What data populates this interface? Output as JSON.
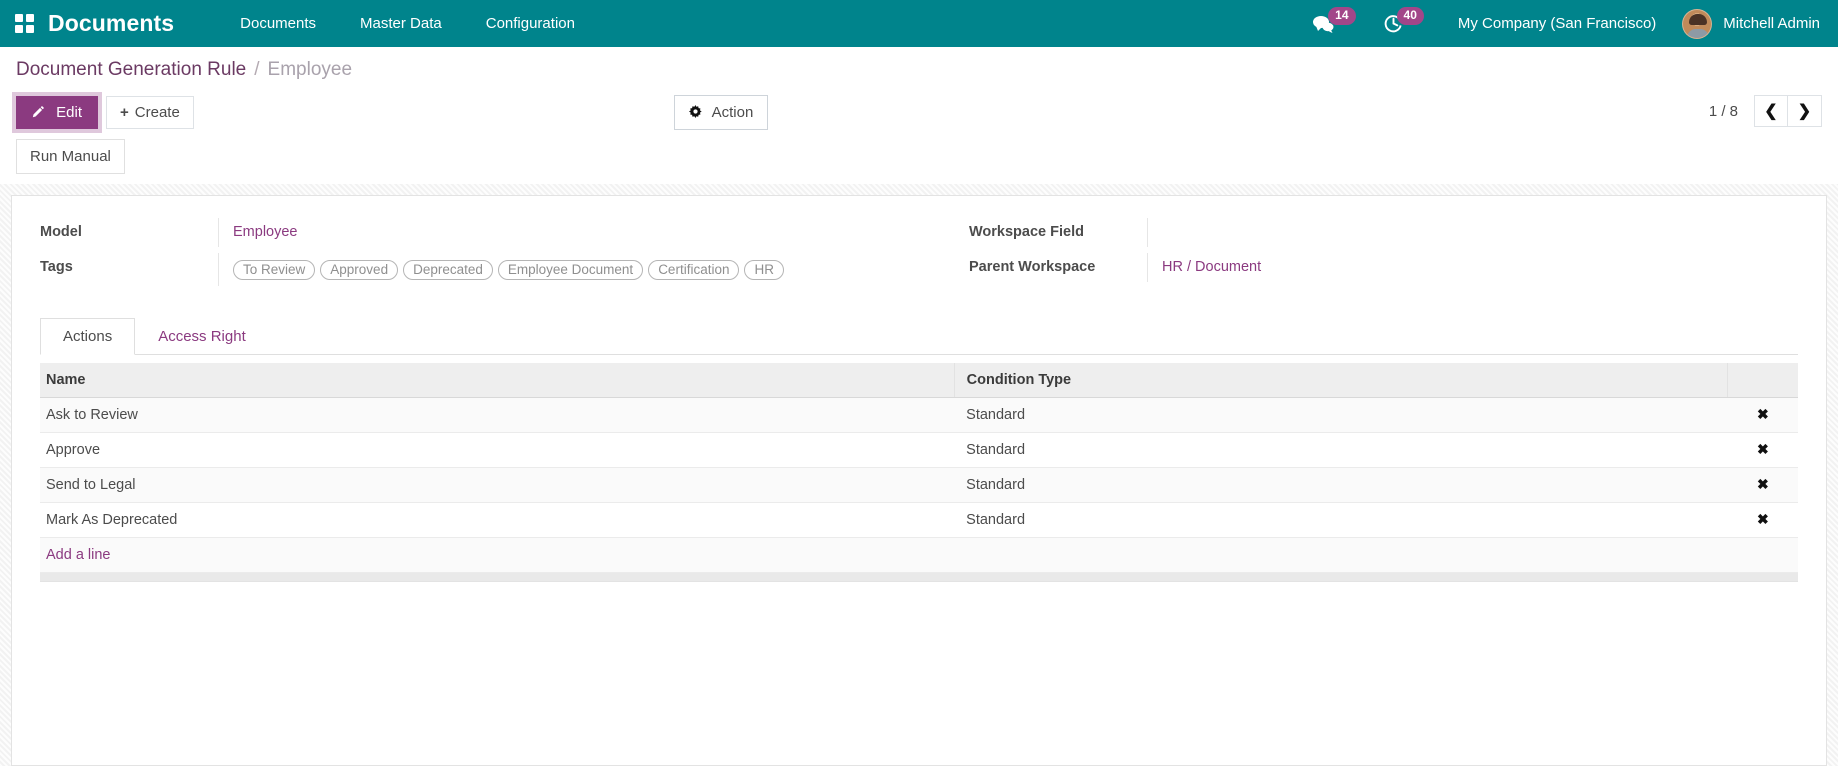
{
  "navbar": {
    "apps_icon": "apps-grid-icon",
    "brand": "Documents",
    "menu": [
      {
        "label": "Documents"
      },
      {
        "label": "Master Data"
      },
      {
        "label": "Configuration"
      }
    ],
    "messages_icon": "chat-bubble-icon",
    "messages_count": "14",
    "activities_icon": "clock-activity-icon",
    "activities_count": "40",
    "company": "My Company (San Francisco)",
    "user_avatar": "user-avatar",
    "user_name": "Mitchell Admin",
    "bg_color": "#00848c",
    "badge_color": "#a24689"
  },
  "breadcrumb": {
    "root": "Document Generation Rule",
    "separator": "/",
    "current": "Employee"
  },
  "control": {
    "edit_label": "Edit",
    "edit_icon": "pencil-icon",
    "create_label": "Create",
    "create_icon": "plus-icon",
    "action_label": "Action",
    "action_icon": "gear-icon",
    "pager_label": "1 / 8",
    "prev_icon": "chevron-left-icon",
    "next_icon": "chevron-right-icon",
    "accent_color": "#8b3a80"
  },
  "statusbar": {
    "run_manual_label": "Run Manual"
  },
  "form": {
    "left": [
      {
        "label": "Model",
        "value": "Employee",
        "type": "link"
      },
      {
        "label": "Tags",
        "type": "tags",
        "tags": [
          "To Review",
          "Approved",
          "Deprecated",
          "Employee Document",
          "Certification",
          "HR"
        ]
      }
    ],
    "right": [
      {
        "label": "Workspace Field",
        "value": "",
        "type": "text"
      },
      {
        "label": "Parent Workspace",
        "value": "HR / Document",
        "type": "link"
      }
    ]
  },
  "notebook": {
    "tabs": [
      {
        "label": "Actions",
        "active": true
      },
      {
        "label": "Access Right",
        "active": false
      }
    ]
  },
  "lines_table": {
    "columns": [
      "Name",
      "Condition Type"
    ],
    "rows": [
      {
        "name": "Ask to Review",
        "condition_type": "Standard",
        "delete_icon": "close-x-icon"
      },
      {
        "name": "Approve",
        "condition_type": "Standard",
        "delete_icon": "close-x-icon"
      },
      {
        "name": "Send to Legal",
        "condition_type": "Standard",
        "delete_icon": "close-x-icon"
      },
      {
        "name": "Mark As Deprecated",
        "condition_type": "Standard",
        "delete_icon": "close-x-icon"
      }
    ],
    "add_line_label": "Add a line"
  }
}
